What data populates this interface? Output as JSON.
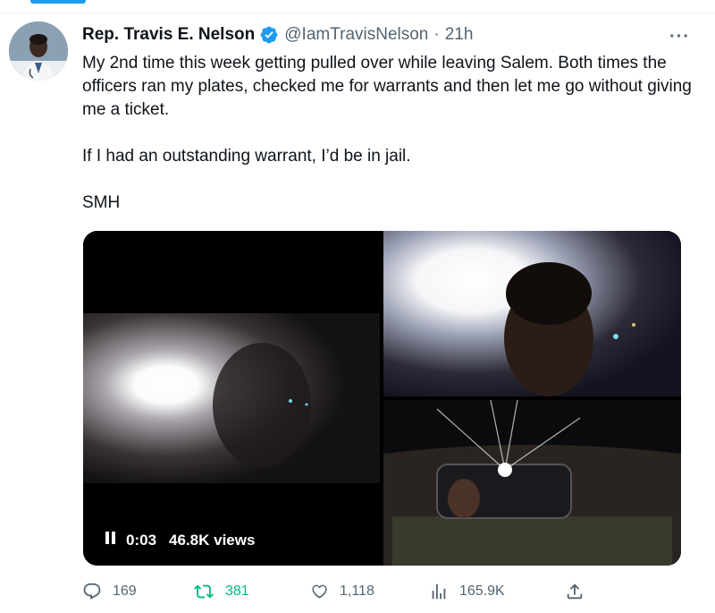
{
  "tweet": {
    "author_name": "Rep. Travis E. Nelson",
    "handle": "@IamTravisNelson",
    "separator": "·",
    "time": "21h",
    "more_label": "···",
    "paragraphs": [
      "My 2nd time this week getting pulled over while leaving Salem. Both times the officers ran my plates, checked me for warrants and then let me go without giving me a ticket.",
      "If I had an outstanding warrant, I’d be in jail.",
      "SMH"
    ],
    "video": {
      "pause_icon": "pause-icon",
      "time": "0:03",
      "views": "46.8K views"
    },
    "stats": {
      "replies": "169",
      "retweets": "381",
      "likes": "1,118",
      "views": "165.9K"
    }
  },
  "colors": {
    "accent": "#1d9bf0",
    "retweet_active": "#00ba7c",
    "muted_text": "#536471"
  },
  "icons": [
    "verified-badge-icon",
    "more-icon",
    "reply-icon",
    "retweet-icon",
    "like-icon",
    "views-icon",
    "share-icon"
  ]
}
